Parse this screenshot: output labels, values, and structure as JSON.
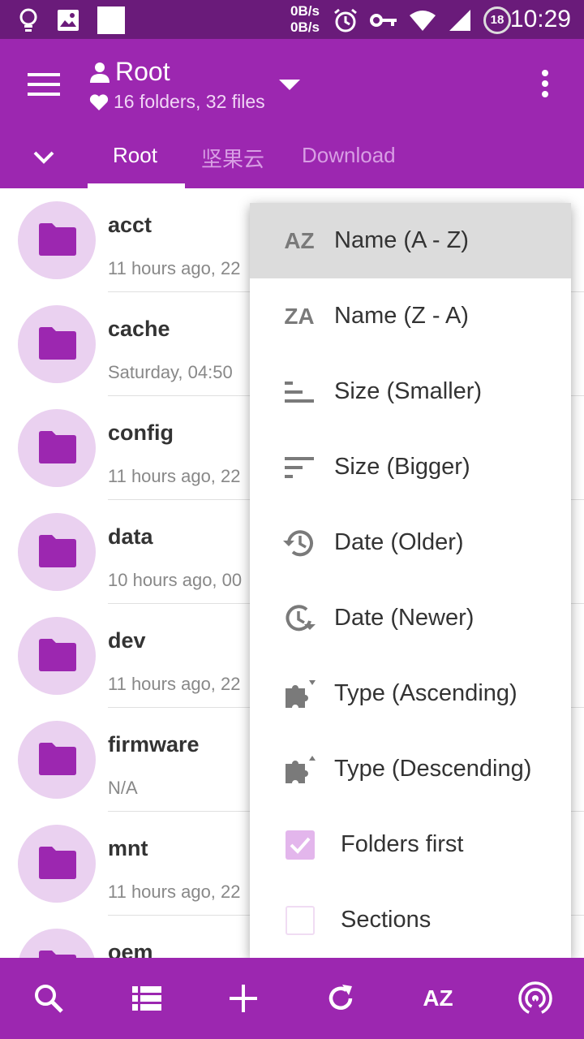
{
  "status_bar": {
    "net_up": "0B/s",
    "net_down": "0B/s",
    "battery_level": "18",
    "time": "10:29"
  },
  "app_bar": {
    "title": "Root",
    "subtitle": "16 folders, 32 files"
  },
  "tabs": [
    {
      "label": "Root",
      "active": true
    },
    {
      "label": "坚果云",
      "active": false
    },
    {
      "label": "Download",
      "active": false
    }
  ],
  "files": [
    {
      "name": "acct",
      "meta": "11 hours ago, 22"
    },
    {
      "name": "cache",
      "meta": "Saturday, 04:50"
    },
    {
      "name": "config",
      "meta": "11 hours ago, 22"
    },
    {
      "name": "data",
      "meta": "10 hours ago, 00"
    },
    {
      "name": "dev",
      "meta": "11 hours ago, 22"
    },
    {
      "name": "firmware",
      "meta": "N/A"
    },
    {
      "name": "mnt",
      "meta": "11 hours ago, 22"
    },
    {
      "name": "oem",
      "meta": ""
    }
  ],
  "sort_menu": {
    "items": [
      {
        "label": "Name (A - Z)",
        "icon": "sort-az-icon",
        "glyph": "AZ",
        "selected": true
      },
      {
        "label": "Name (Z - A)",
        "icon": "sort-za-icon",
        "glyph": "ZA",
        "selected": false
      },
      {
        "label": "Size (Smaller)",
        "icon": "size-ascending-icon",
        "selected": false
      },
      {
        "label": "Size (Bigger)",
        "icon": "size-descending-icon",
        "selected": false
      },
      {
        "label": "Date (Older)",
        "icon": "history-icon",
        "selected": false
      },
      {
        "label": "Date (Newer)",
        "icon": "clock-forward-icon",
        "selected": false
      },
      {
        "label": "Type (Ascending)",
        "icon": "puzzle-ascending-icon",
        "selected": false
      },
      {
        "label": "Type (Descending)",
        "icon": "puzzle-descending-icon",
        "selected": false
      }
    ],
    "folders_first": {
      "label": "Folders first",
      "checked": true
    },
    "sections": {
      "label": "Sections",
      "checked": false
    }
  },
  "bottom_bar": {
    "sort_label": "AZ"
  },
  "colors": {
    "primary": "#9c27b0",
    "primary_dark": "#6a1b7a",
    "folder_bg": "#ead1f0",
    "folder_icon": "#9c27b0"
  }
}
